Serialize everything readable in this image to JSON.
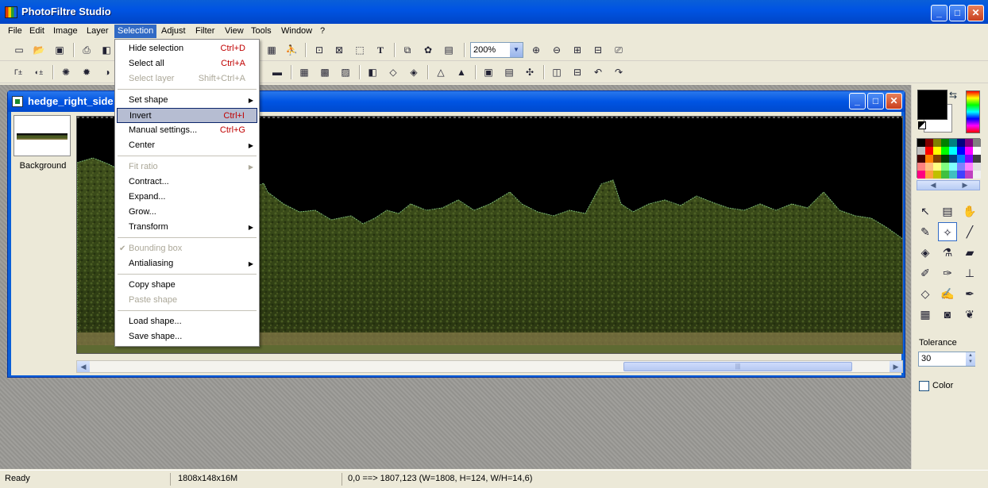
{
  "window": {
    "title": "PhotoFiltre Studio",
    "minimize": "_",
    "maximize": "□",
    "close": "✕"
  },
  "menubar": [
    "File",
    "Edit",
    "Image",
    "Layer",
    "Selection",
    "Adjust",
    "Filter",
    "View",
    "Tools",
    "Window",
    "?"
  ],
  "toolbar": {
    "zoom": "200%"
  },
  "document": {
    "title": "hedge_right_side",
    "layer_name": "Background"
  },
  "selection_menu": {
    "items": [
      {
        "label": "Hide selection",
        "shortcut": "Ctrl+D"
      },
      {
        "label": "Select all",
        "shortcut": "Ctrl+A"
      },
      {
        "label": "Select layer",
        "shortcut": "Shift+Ctrl+A"
      },
      {
        "label": "Set shape"
      },
      {
        "label": "Invert",
        "shortcut": "Ctrl+I"
      },
      {
        "label": "Manual settings...",
        "shortcut": "Ctrl+G"
      },
      {
        "label": "Center"
      },
      {
        "label": "Fit ratio"
      },
      {
        "label": "Contract..."
      },
      {
        "label": "Expand..."
      },
      {
        "label": "Grow..."
      },
      {
        "label": "Transform"
      },
      {
        "label": "Bounding box"
      },
      {
        "label": "Antialiasing"
      },
      {
        "label": "Copy shape"
      },
      {
        "label": "Paste shape"
      },
      {
        "label": "Load shape..."
      },
      {
        "label": "Save shape..."
      }
    ]
  },
  "panel": {
    "tolerance_label": "Tolerance",
    "tolerance_value": "30",
    "color_label": "Color"
  },
  "status": {
    "state": "Ready",
    "image_info": "1808x148x16M",
    "coords": "0,0 ==> 1807,123 (W=1808, H=124, W/H=14,6)"
  },
  "icons": {
    "app": "photofiltre-icon",
    "doc": "image-doc-icon"
  },
  "colors": {
    "accent": "#0054e3",
    "menu_highlight": "#316ac5"
  }
}
